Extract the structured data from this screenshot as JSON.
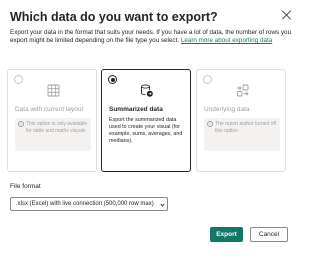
{
  "dialog": {
    "title": "Which data do you want to export?",
    "description": "Export your data in the format that suits your needs. If you have a lot of data, the number of rows you export might be limited depending on the file type you select.",
    "learn_more": "Learn more about exporting data"
  },
  "options": [
    {
      "title": "Data with current layout",
      "note": "This option is only available for table and matrix visuals",
      "selected": false,
      "icon": "table-layout-icon"
    },
    {
      "title": "Summarized data",
      "body": "Export the summarized data used to create your visual (for example, sums, averages, and medians).",
      "selected": true,
      "icon": "database-export-icon"
    },
    {
      "title": "Underlying data",
      "note": "The report author turned off this option",
      "selected": false,
      "icon": "underlying-data-icon"
    }
  ],
  "file_format": {
    "label": "File format",
    "value": ".xlsx (Excel) with live connection (500,000 row max)"
  },
  "buttons": {
    "export": "Export",
    "cancel": "Cancel"
  },
  "colors": {
    "accent": "#117865",
    "text": "#252423",
    "disabled": "#a19f9d"
  }
}
